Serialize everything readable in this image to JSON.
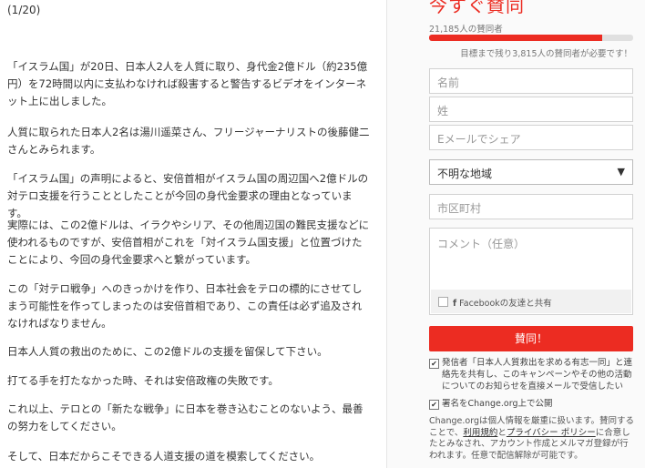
{
  "article": {
    "page_indicator": "(1/20)",
    "paragraphs": [
      "「イスラム国」が20日、日本人2人を人質に取り、身代金2億ドル（約235億円）を72時間以内に支払わなければ殺害すると警告するビデオをインターネット上に出しました。",
      "人質に取られた日本人2名は湯川遥菜さん、フリージャーナリストの後藤健二さんとみられます。",
      "「イスラム国」の声明によると、安倍首相がイスラム国の周辺国へ2億ドルの対テロ支援を行うこととしたことが今回の身代金要求の理由となっています。",
      "実際には、この2億ドルは、イラクやシリア、その他周辺国の難民支援などに使われるものですが、安倍首相がこれを「対イスラム国支援」と位置づけたことにより、今回の身代金要求へと繋がっています。",
      "この「対テロ戦争」へのきっかけを作り、日本社会をテロの標的にさせてしまう可能性を作ってしまったのは安倍首相であり、この責任は必ず追及されなければなりません。",
      "日本人人質の救出のために、この2億ドルの支援を留保して下さい。",
      "打てる手を打たなかった時、それは安倍政権の失敗です。",
      "これ以上、テロとの「新たな戦争」に日本を巻き込むことのないよう、最善の努力をしてください。",
      "そして、日本だからこそできる人道支援の道を模索してください。"
    ]
  },
  "petition": {
    "cta_title": "今すぐ賛同",
    "supporters_text": "21,185人の賛同者",
    "progress_fraction": 0.85,
    "remaining_text": "目標まで残り3,815人の賛同者が必要です！",
    "fields": {
      "first_name_placeholder": "名前",
      "last_name_placeholder": "姓",
      "email_placeholder": "Eメールでシェア",
      "region_selected": "不明な地域",
      "city_placeholder": "市区町村",
      "comment_placeholder": "コメント（任意）"
    },
    "facebook_share_label": "Facebookの友達と共有",
    "submit_label": "賛同！",
    "consent_text": "発信者「日本人人質救出を求める有志一同」と連絡先を共有し、このキャンペーンやその他の活動についてのお知らせを直接メールで受信したい",
    "public_signature_text": "署名をChange.org上で公開",
    "legal": {
      "part1": "Change.orgは個人情報を厳重に扱います。賛同することで、",
      "terms_link": "利用規約",
      "conj": "と",
      "privacy_link": "プライバシー ポリシー",
      "part2": "に合意したとみなされ、アカウント作成とメルマガ登録が行われます。任意で配信解除が可能です。"
    }
  },
  "colors": {
    "accent": "#ec2c22"
  }
}
